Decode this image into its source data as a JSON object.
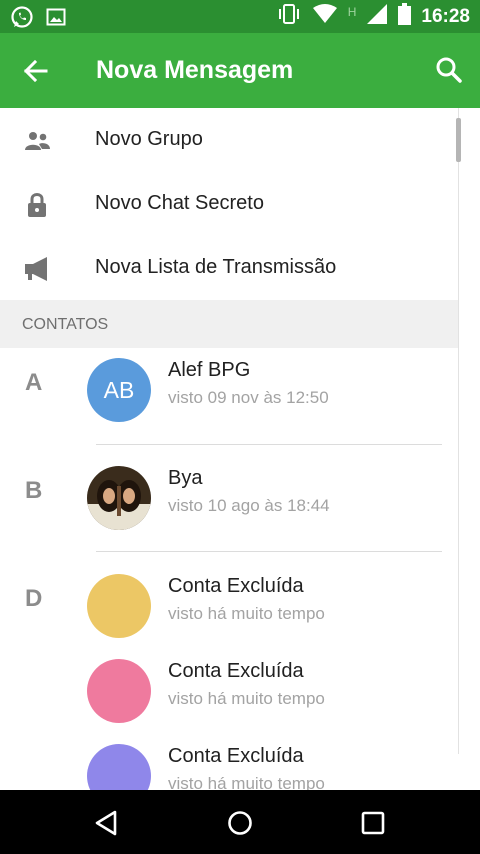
{
  "status_bar": {
    "time": "16:28",
    "network": "H",
    "left_icons": [
      "whatsapp-icon",
      "image-icon"
    ],
    "right_icons": [
      "vibrate-icon",
      "wifi-icon",
      "signal-icon",
      "battery-icon"
    ]
  },
  "toolbar": {
    "title": "Nova Mensagem",
    "back_icon": "arrow-left-icon",
    "search_icon": "search-icon",
    "background": "#3bae3f"
  },
  "menu": {
    "items": [
      {
        "label": "Novo Grupo",
        "icon": "group-icon"
      },
      {
        "label": "Novo Chat Secreto",
        "icon": "lock-icon"
      },
      {
        "label": "Nova Lista de Transmissão",
        "icon": "megaphone-icon"
      }
    ]
  },
  "contacts": {
    "header": "CONTATOS",
    "items": [
      {
        "letter": "A",
        "initials": "AB",
        "name": "Alef BPG",
        "status": "visto 09 nov às 12:50",
        "avatar_color": "#5a9bdc"
      },
      {
        "letter": "B",
        "initials": "",
        "name": "Bya",
        "status": "visto 10 ago às 18:44",
        "avatar_color": "#3a2c1c"
      },
      {
        "letter": "D",
        "initials": "",
        "name": "Conta Excluída",
        "status": "visto há muito tempo",
        "avatar_color": "#ecc765"
      },
      {
        "letter": "",
        "initials": "",
        "name": "Conta Excluída",
        "status": "visto há muito tempo",
        "avatar_color": "#ef7a9e"
      },
      {
        "letter": "",
        "initials": "",
        "name": "Conta Excluída",
        "status": "visto há muito tempo",
        "avatar_color": "#8f87ea"
      }
    ]
  },
  "nav_bar": {
    "buttons": [
      "back-triangle-icon",
      "home-circle-icon",
      "recents-square-icon"
    ]
  }
}
